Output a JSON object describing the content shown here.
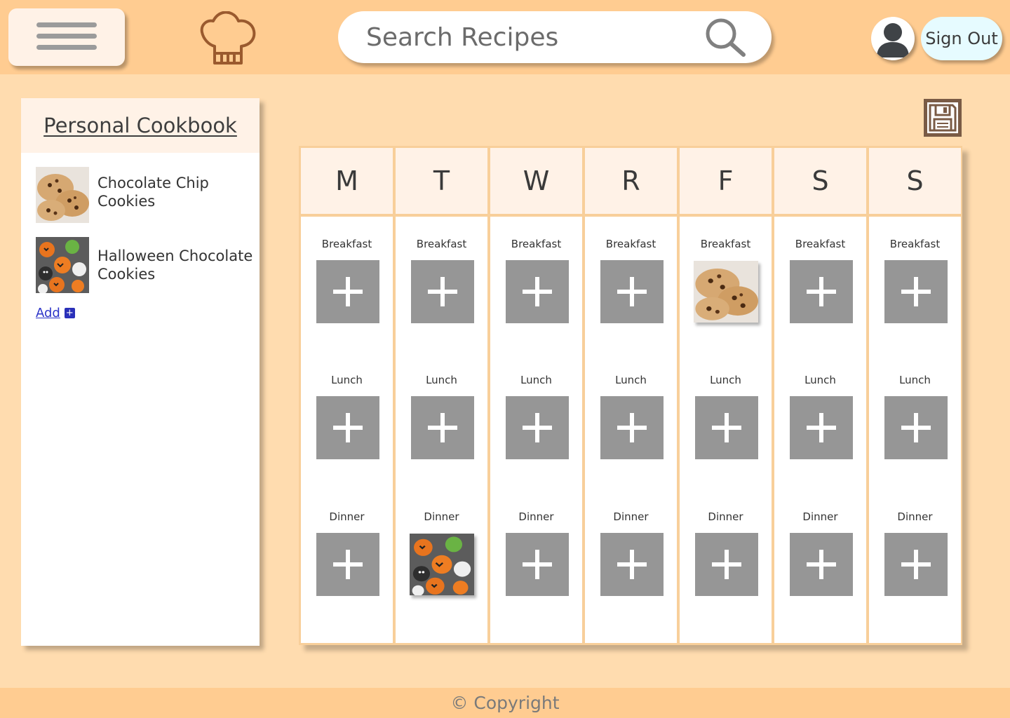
{
  "header": {
    "search_placeholder": "Search Recipes",
    "sign_out_label": "Sign Out",
    "icons": [
      "menu-icon",
      "chef-hat-icon",
      "search-icon",
      "user-avatar-icon"
    ]
  },
  "cookbook": {
    "title": "Personal Cookbook",
    "recipes": [
      {
        "name": "Chocolate Chip Cookies",
        "image": "chocolate-chip-cookies-image"
      },
      {
        "name": "Halloween Chocolate Cookies",
        "image": "halloween-cookies-image"
      }
    ],
    "add_label": "Add",
    "add_icon": "+"
  },
  "planner": {
    "save_icon": "floppy-disk-icon",
    "meals": [
      "Breakfast",
      "Lunch",
      "Dinner"
    ],
    "days": [
      {
        "letter": "M",
        "breakfast": "",
        "lunch": "",
        "dinner": ""
      },
      {
        "letter": "T",
        "breakfast": "",
        "lunch": "",
        "dinner": "Halloween Chocolate Cookies"
      },
      {
        "letter": "W",
        "breakfast": "",
        "lunch": "",
        "dinner": ""
      },
      {
        "letter": "R",
        "breakfast": "",
        "lunch": "",
        "dinner": ""
      },
      {
        "letter": "F",
        "breakfast": "Chocolate Chip Cookies",
        "lunch": "",
        "dinner": ""
      },
      {
        "letter": "S",
        "breakfast": "",
        "lunch": "",
        "dinner": ""
      },
      {
        "letter": "S",
        "breakfast": "",
        "lunch": "",
        "dinner": ""
      }
    ]
  },
  "footer": {
    "copyright": "© Copyright"
  },
  "colors": {
    "header_bg": "#ffcc91",
    "page_bg": "#ffdcaf",
    "panel_head_bg": "#fff2e7",
    "slot_gray": "#969696",
    "grid_border": "#f8cf9a",
    "link_blue": "#2c34c8",
    "signout_bg": "#e6fbff"
  }
}
